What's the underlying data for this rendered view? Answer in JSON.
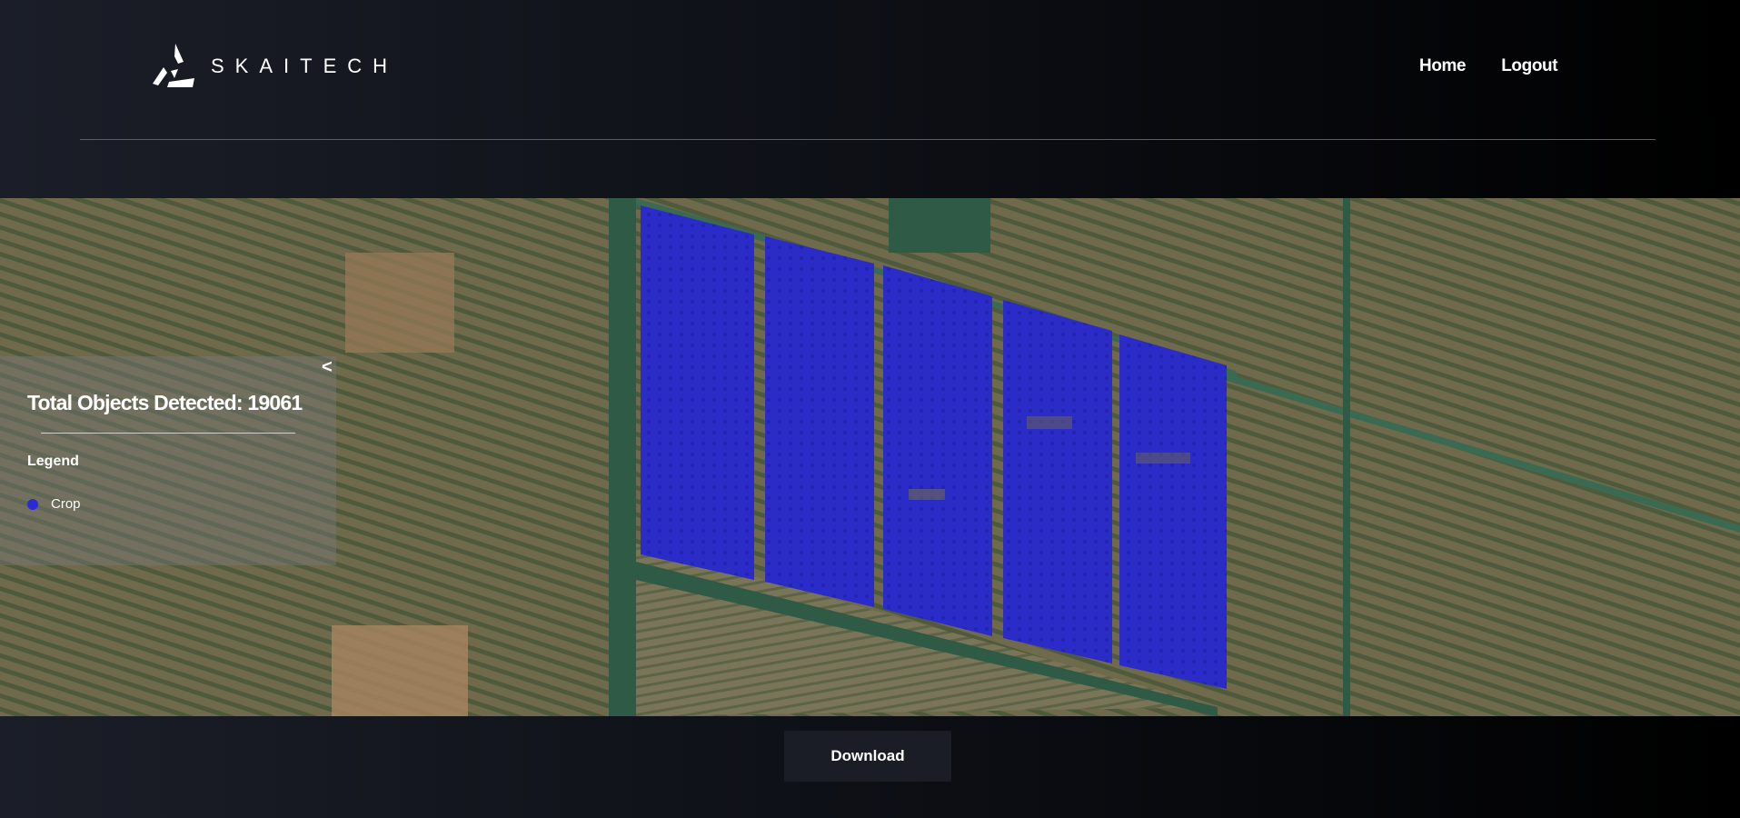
{
  "header": {
    "brand": "SKAITECH",
    "nav": {
      "home": "Home",
      "logout": "Logout"
    }
  },
  "panel": {
    "collapse_label": "<",
    "total_label": "Total Objects Detected: 19061",
    "legend_title": "Legend",
    "legend_items": [
      {
        "label": "Crop",
        "color": "#2b2bd6"
      }
    ]
  },
  "footer": {
    "download_label": "Download"
  },
  "colors": {
    "detection": "#2b2bd6",
    "canal": "#2e5a46",
    "field": "#6e6a4c"
  }
}
